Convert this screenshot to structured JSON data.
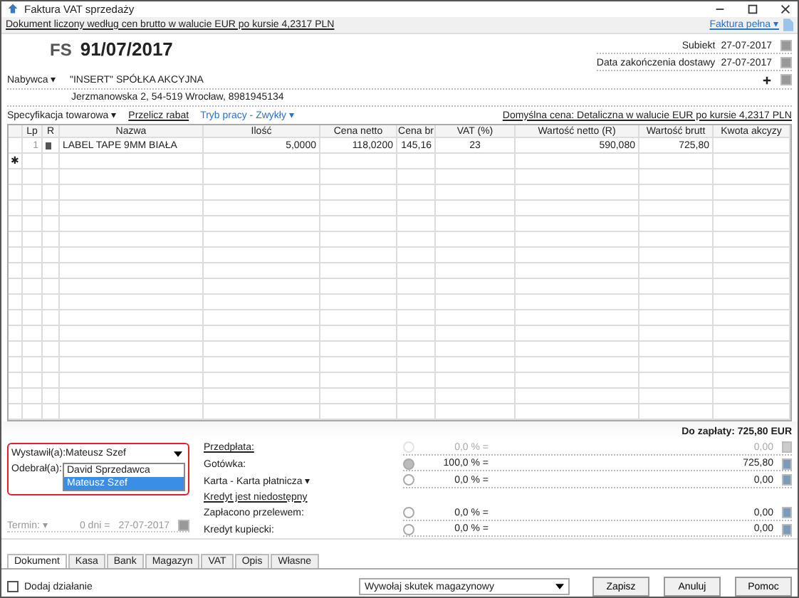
{
  "window": {
    "title": "Faktura VAT sprzedaży"
  },
  "info_bar": {
    "text": "Dokument liczony według cen brutto w walucie EUR po kursie 4,2317 PLN",
    "document_type": "Faktura pełna ▾"
  },
  "header": {
    "prefix": "FS",
    "number": "91/07/2017",
    "dates": [
      {
        "label": "Subiekt",
        "value": "27-07-2017"
      },
      {
        "label": "Data zakończenia dostawy",
        "value": "27-07-2017"
      }
    ],
    "buyer_label": "Nabywca ▾",
    "buyer_name": "\"INSERT\" SPÓŁKA AKCYJNA",
    "buyer_address": "Jerzmanowska 2, 54-519 Wrocław, 8981945134"
  },
  "toolbar": {
    "items": [
      {
        "label": "Specyfikacja towarowa ▾",
        "kind": "menu"
      },
      {
        "label": "Przelicz rabat",
        "kind": "link"
      },
      {
        "label": "Tryb pracy - Zwykły ▾",
        "kind": "mode"
      }
    ],
    "default_price": "Domyślna cena: Detaliczna w walucie EUR po kursie 4,2317 PLN"
  },
  "table": {
    "columns": [
      "Lp",
      "R",
      "Nazwa",
      "Ilość",
      "Cena netto",
      "Cena br",
      "VAT (%)",
      "Wartość netto (R)",
      "Wartość brutt",
      "Kwota akcyzy"
    ],
    "rows": [
      {
        "cells": [
          "1",
          "",
          "LABEL TAPE 9MM BIAŁA",
          "5,0000",
          "118,0200",
          "145,16",
          "23",
          "590,080",
          "725,80",
          ""
        ]
      }
    ],
    "new_row_marker": "✱"
  },
  "total": "Do zapłaty: 725,80 EUR",
  "issuer": {
    "label": "Wystawił(a):",
    "value": "Mateusz Szef",
    "options": [
      {
        "label": "David Sprzedawca",
        "selected": false
      },
      {
        "label": "Mateusz Szef",
        "selected": true
      }
    ],
    "receiver_label": "Odebrał(a):"
  },
  "due": {
    "label": "Termin: ▾",
    "days": "0 dni =",
    "date": "27-07-2017"
  },
  "payments": [
    {
      "label": "Przedpłata:",
      "kind": "link",
      "disabled": true,
      "selected": false,
      "percent": "0,0 % =",
      "amount": "0,00"
    },
    {
      "label": "Gotówka:",
      "kind": "plain",
      "disabled": false,
      "selected": true,
      "percent": "100,0 % =",
      "amount": "725,80"
    },
    {
      "label": "Karta - Karta płatnicza ▾",
      "kind": "plain",
      "disabled": false,
      "selected": false,
      "percent": "0,0 % =",
      "amount": "0,00"
    },
    {
      "label": "Kredyt jest niedostępny",
      "kind": "note"
    },
    {
      "label": "Zapłacono przelewem:",
      "kind": "plain",
      "disabled": false,
      "selected": false,
      "percent": "0,0 % =",
      "amount": "0,00"
    },
    {
      "label": "Kredyt kupiecki:",
      "kind": "plain",
      "disabled": false,
      "selected": false,
      "percent": "0,0 % =",
      "amount": "0,00"
    }
  ],
  "tabs": [
    {
      "label": "Dokument",
      "selected": true
    },
    {
      "label": "Kasa",
      "selected": false
    },
    {
      "label": "Bank",
      "selected": false
    },
    {
      "label": "Magazyn",
      "selected": false
    },
    {
      "label": "VAT",
      "selected": false
    },
    {
      "label": "Opis",
      "selected": false
    },
    {
      "label": "Własne",
      "selected": false
    }
  ],
  "footer": {
    "checkbox": {
      "label": "Dodaj działanie",
      "checked": false
    },
    "action_select": "Wywołaj skutek magazynowy",
    "buttons": [
      "Zapisz",
      "Anuluj",
      "Pomoc"
    ]
  }
}
